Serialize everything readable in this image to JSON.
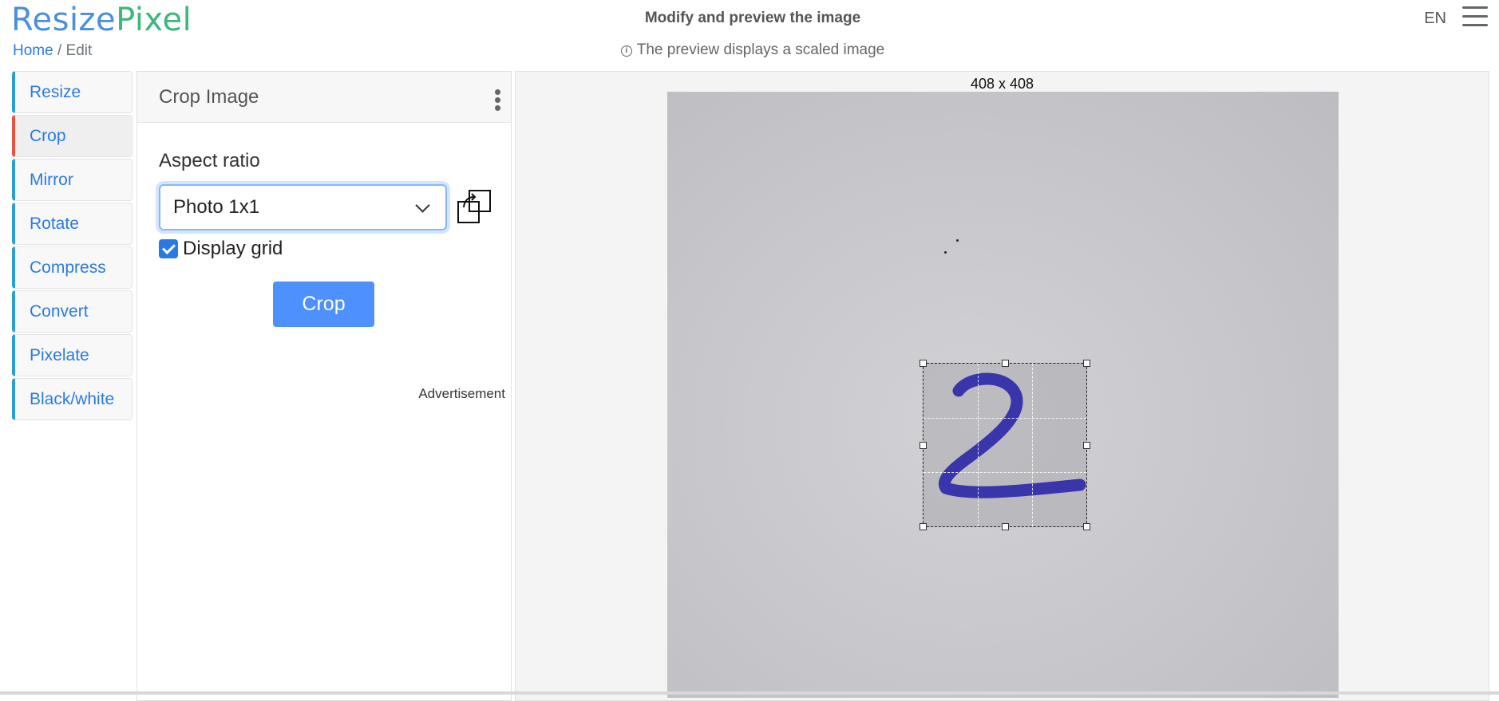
{
  "brand": {
    "part1": "Resize",
    "part2": "Pixel"
  },
  "breadcrumb": {
    "home": "Home",
    "separator": " / ",
    "current": "Edit"
  },
  "header": {
    "title": "Modify and preview the image",
    "note": "The preview displays a scaled image",
    "language": "EN"
  },
  "sidebar": {
    "items": [
      {
        "label": "Resize",
        "active": false
      },
      {
        "label": "Crop",
        "active": true
      },
      {
        "label": "Mirror",
        "active": false
      },
      {
        "label": "Rotate",
        "active": false
      },
      {
        "label": "Compress",
        "active": false
      },
      {
        "label": "Convert",
        "active": false
      },
      {
        "label": "Pixelate",
        "active": false
      },
      {
        "label": "Black/white",
        "active": false
      }
    ]
  },
  "panel": {
    "title": "Crop Image",
    "aspect_label": "Aspect ratio",
    "aspect_value": "Photo 1x1",
    "display_grid_label": "Display grid",
    "display_grid_checked": true,
    "crop_button": "Crop",
    "ad_label": "Advertisement"
  },
  "preview": {
    "dimensions": "408 x 408",
    "digit": "2"
  },
  "colors": {
    "brand_blue": "#4a90d9",
    "brand_green": "#3cb878",
    "link": "#2a7ae2",
    "active_marker": "#e8543d",
    "button": "#4d90fe",
    "ink": "#2c2aa8"
  },
  "icons": {
    "info": "info-circle-icon",
    "menu": "hamburger-menu-icon",
    "more": "kebab-menu-icon",
    "select": "chevron-down-icon",
    "swap": "swap-orientation-icon",
    "check": "checkmark-icon"
  }
}
